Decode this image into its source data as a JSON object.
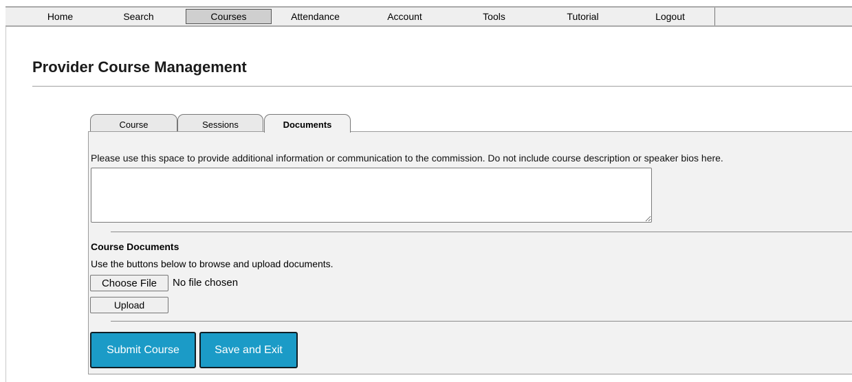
{
  "nav": {
    "items": [
      {
        "label": "Home"
      },
      {
        "label": "Search"
      },
      {
        "label": "Courses"
      },
      {
        "label": "Attendance"
      },
      {
        "label": "Account"
      },
      {
        "label": "Tools"
      },
      {
        "label": "Tutorial"
      },
      {
        "label": "Logout"
      }
    ],
    "active_index": 2
  },
  "page": {
    "title": "Provider Course Management"
  },
  "tabs": [
    {
      "label": "Course"
    },
    {
      "label": "Sessions"
    },
    {
      "label": "Documents"
    }
  ],
  "active_tab_index": 2,
  "documents": {
    "instruction": "Please use this space to provide additional information or communication to the commission. Do not include course description or speaker bios here.",
    "notes_value": "",
    "heading": "Course Documents",
    "help_text": "Use the buttons below to browse and upload documents.",
    "choose_file_label": "Choose File",
    "file_status": "No file chosen",
    "upload_label": "Upload"
  },
  "actions": {
    "submit_label": "Submit Course",
    "save_exit_label": "Save and Exit"
  },
  "colors": {
    "action_button": "#1b9bc7",
    "panel_bg": "#f2f2f2",
    "nav_bg": "#efefef"
  }
}
